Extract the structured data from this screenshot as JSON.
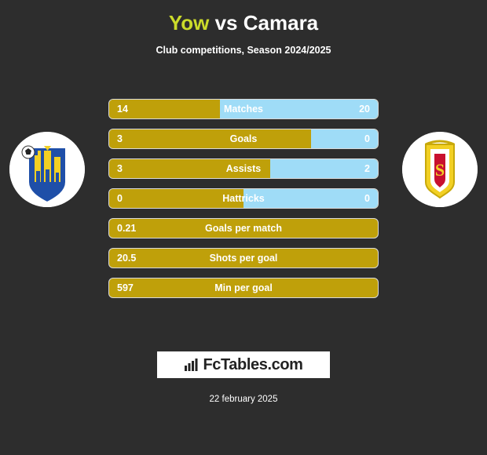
{
  "header": {
    "home_player": "Yow",
    "vs": "vs",
    "away_player": "Camara",
    "subtitle": "Club competitions, Season 2024/2025"
  },
  "crests": {
    "left_name": "home-club-crest",
    "right_name": "away-club-crest"
  },
  "logo": {
    "text": "FcTables.com",
    "icon": "bar-chart-icon"
  },
  "footer": {
    "date": "22 february 2025"
  },
  "colors": {
    "background": "#2d2d2d",
    "home_bar": "#bfa00a",
    "away_bar": "#9fdcf7",
    "title_accent": "#cbdb2a",
    "text": "#ffffff"
  },
  "chart_data": {
    "type": "bar",
    "title": "Yow vs Camara",
    "subtitle": "Club competitions, Season 2024/2025",
    "orientation": "horizontal-diverging",
    "series": [
      {
        "name": "Yow",
        "color": "#bfa00a"
      },
      {
        "name": "Camara",
        "color": "#9fdcf7"
      }
    ],
    "categories": [
      "Matches",
      "Goals",
      "Assists",
      "Hattricks",
      "Goals per match",
      "Shots per goal",
      "Min per goal"
    ],
    "rows": [
      {
        "label": "Matches",
        "left": "14",
        "right": "20",
        "left_pct": 41.2,
        "right_pct": 58.8,
        "split": true
      },
      {
        "label": "Goals",
        "left": "3",
        "right": "0",
        "left_pct": 75.0,
        "right_pct": 25.0,
        "split": true
      },
      {
        "label": "Assists",
        "left": "3",
        "right": "2",
        "left_pct": 60.0,
        "right_pct": 40.0,
        "split": true
      },
      {
        "label": "Hattricks",
        "left": "0",
        "right": "0",
        "left_pct": 50.0,
        "right_pct": 50.0,
        "split": true
      },
      {
        "label": "Goals per match",
        "left": "0.21",
        "right": "",
        "left_pct": 100,
        "right_pct": 0,
        "split": false
      },
      {
        "label": "Shots per goal",
        "left": "20.5",
        "right": "",
        "left_pct": 100,
        "right_pct": 0,
        "split": false
      },
      {
        "label": "Min per goal",
        "left": "597",
        "right": "",
        "left_pct": 100,
        "right_pct": 0,
        "split": false
      }
    ],
    "footer_date": "22 february 2025"
  }
}
